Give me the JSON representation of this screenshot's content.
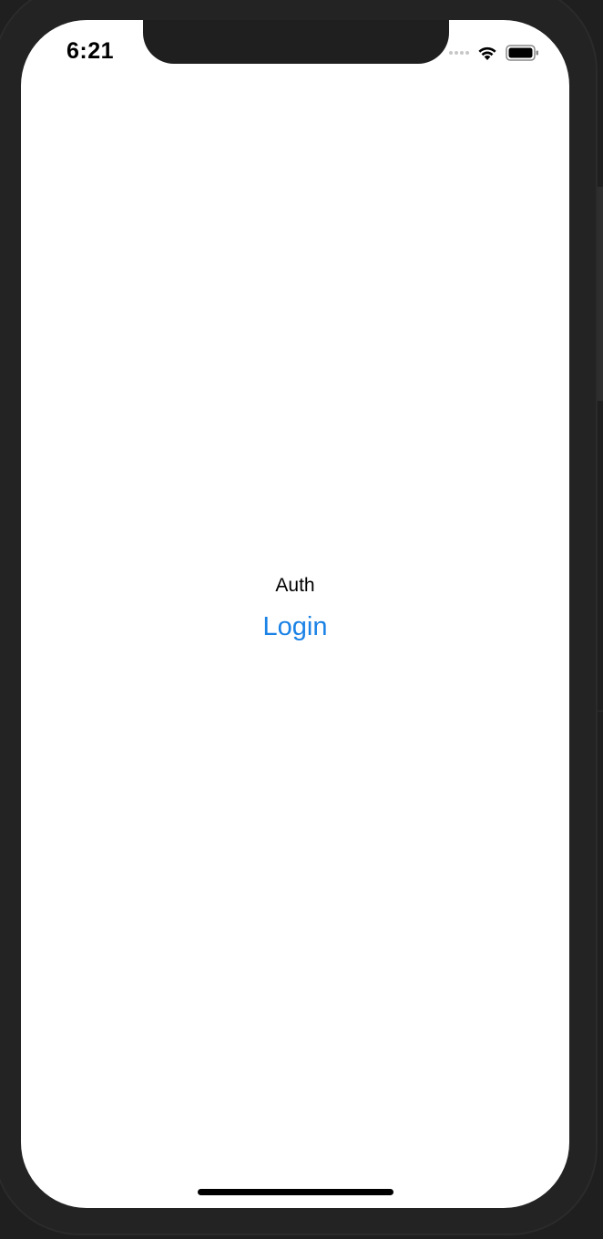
{
  "status_bar": {
    "time": "6:21",
    "signal_icon": "cellular-signal-icon",
    "wifi_icon": "wifi-icon",
    "battery_icon": "battery-icon"
  },
  "main": {
    "title": "Auth",
    "login_label": "Login"
  },
  "colors": {
    "accent": "#1a82e6",
    "background": "#ffffff",
    "text": "#000000"
  }
}
